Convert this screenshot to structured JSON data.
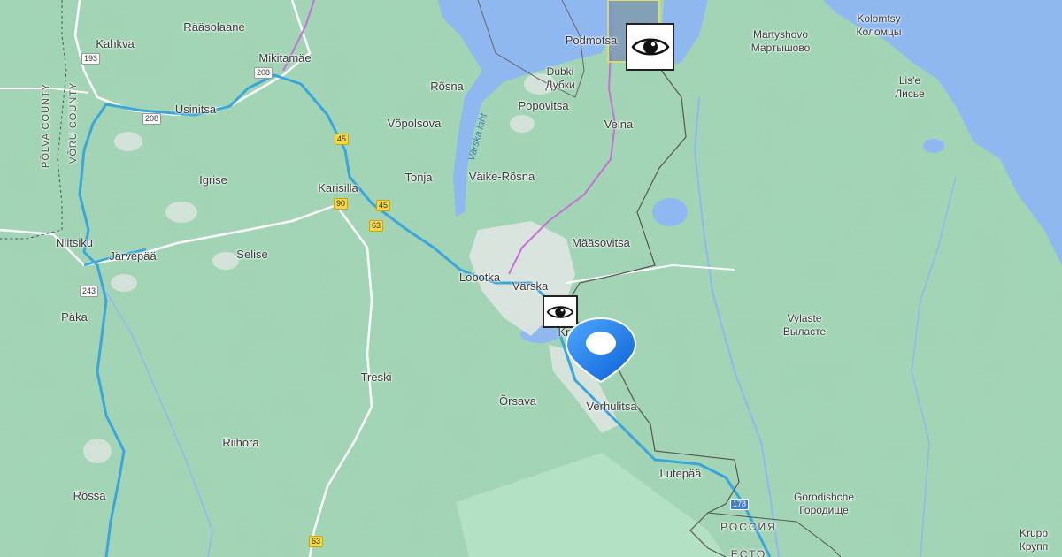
{
  "map": {
    "place_labels": [
      {
        "id": "raasolaane",
        "text": "Rääsolaane"
      },
      {
        "id": "kahkva",
        "text": "Kahkva"
      },
      {
        "id": "mikitamae",
        "text": "Mikitamäe"
      },
      {
        "id": "podmotsa",
        "text": "Podmotsa"
      },
      {
        "id": "martyshovo",
        "text": "Martyshovo\nМартышово"
      },
      {
        "id": "kolomtsy",
        "text": "Kolomtsy\nКоломцы"
      },
      {
        "id": "dubki",
        "text": "Dubki\nДубки"
      },
      {
        "id": "rosna",
        "text": "Rõsna"
      },
      {
        "id": "usinitsa",
        "text": "Usinitsa"
      },
      {
        "id": "popovitsa",
        "text": "Popovitsa"
      },
      {
        "id": "lise",
        "text": "Lis'e\nЛисье"
      },
      {
        "id": "vopolsova",
        "text": "Võpolsova"
      },
      {
        "id": "velna",
        "text": "Velna"
      },
      {
        "id": "igrise",
        "text": "Igrise"
      },
      {
        "id": "tonja",
        "text": "Tonja"
      },
      {
        "id": "vaike-rosna",
        "text": "Väike-Rõsna"
      },
      {
        "id": "karisilla",
        "text": "Karisilla"
      },
      {
        "id": "niitsiku",
        "text": "Niitsiku"
      },
      {
        "id": "maasovitsa",
        "text": "Määsovitsa"
      },
      {
        "id": "jarvepaa",
        "text": "Järvepää"
      },
      {
        "id": "selise",
        "text": "Selise"
      },
      {
        "id": "lobotka",
        "text": "Lobotka"
      },
      {
        "id": "varska",
        "text": "Värska"
      },
      {
        "id": "paka",
        "text": "Päka"
      },
      {
        "id": "vylaste",
        "text": "Vylaste\nВыласте"
      },
      {
        "id": "treski",
        "text": "Treski"
      },
      {
        "id": "orsava",
        "text": "Õrsava"
      },
      {
        "id": "verhulitsa",
        "text": "Verhulitsa"
      },
      {
        "id": "riihora",
        "text": "Riihora"
      },
      {
        "id": "lutepaa",
        "text": "Lutepää"
      },
      {
        "id": "gorodishche",
        "text": "Gorodishche\nГородище"
      },
      {
        "id": "rossa",
        "text": "Rõssa"
      },
      {
        "id": "krupp",
        "text": "Krupp\nКрупп"
      },
      {
        "id": "kr-partial",
        "text": "Kr"
      }
    ],
    "water_labels": [
      {
        "id": "varska-laht",
        "text": "Värska laht"
      }
    ],
    "county_labels": [
      {
        "id": "polva-county",
        "text": "PÕLVA COUNTY"
      },
      {
        "id": "voru-county",
        "text": "VÕRU COUNTY"
      }
    ],
    "country_labels": [
      {
        "id": "russia",
        "text": "РОССИЯ"
      },
      {
        "id": "estonia-partial",
        "text": "ЕСТО"
      }
    ],
    "road_shields": [
      {
        "id": "r193",
        "text": "193",
        "style": "white"
      },
      {
        "id": "r208a",
        "text": "208",
        "style": "white"
      },
      {
        "id": "r208b",
        "text": "208",
        "style": "white"
      },
      {
        "id": "r45a",
        "text": "45",
        "style": "yellow"
      },
      {
        "id": "r90",
        "text": "90",
        "style": "yellow"
      },
      {
        "id": "r45b",
        "text": "45",
        "style": "yellow"
      },
      {
        "id": "r63a",
        "text": "63",
        "style": "yellow"
      },
      {
        "id": "r243",
        "text": "243",
        "style": "white"
      },
      {
        "id": "r63b",
        "text": "63",
        "style": "yellow"
      },
      {
        "id": "r178",
        "text": "178",
        "style": "blue"
      }
    ],
    "markers": [
      {
        "id": "eye-marker-podmotsa",
        "icon": "eye-icon"
      },
      {
        "id": "eye-marker-varska",
        "icon": "eye-icon"
      },
      {
        "id": "location-pin",
        "icon": "location-pin-icon",
        "color": "#1a73e8"
      }
    ],
    "colors": {
      "land": "#9fd3b3",
      "water": "#8fb8f0",
      "route": "#3aa6dc",
      "boundary": "#666666",
      "highlight_rail": "#c86fd8",
      "selection_box": "#7a8fb8"
    }
  }
}
